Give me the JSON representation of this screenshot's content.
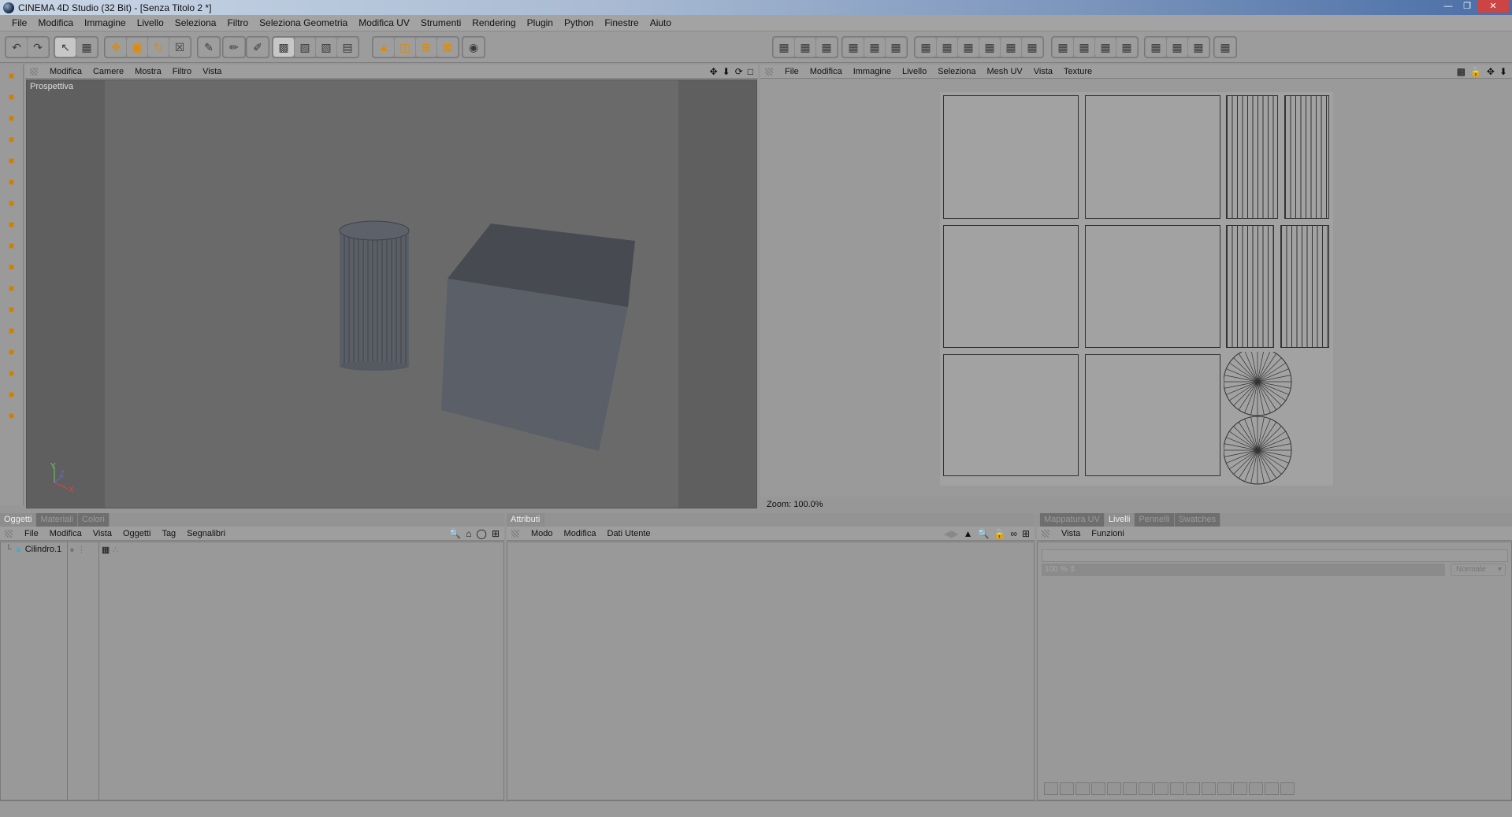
{
  "window": {
    "title": "CINEMA 4D Studio (32 Bit) - [Senza Titolo 2 *]",
    "controls": [
      "minimize",
      "restore",
      "close"
    ]
  },
  "menu": [
    "File",
    "Modifica",
    "Immagine",
    "Livello",
    "Seleziona",
    "Filtro",
    "Seleziona Geometria",
    "Modifica UV",
    "Strumenti",
    "Rendering",
    "Plugin",
    "Python",
    "Finestre",
    "Aiuto"
  ],
  "toolbar_left": [
    "undo-icon",
    "redo-icon",
    "live-selection-icon",
    "rectangle-select-icon",
    "move-icon",
    "scale-icon",
    "rotate-icon",
    "lock-texture-icon",
    "paint-icon",
    "3d-paint-icon",
    "brush-icon",
    "texture-mode-icon",
    "uv-points-icon",
    "uv-polygons-icon",
    "uv-edit-icon",
    "axis-icon",
    "layout-1-icon",
    "layout-2-icon",
    "layout-3-icon",
    "render-icon"
  ],
  "toolbar_right": [
    "uv-tool-1",
    "uv-tool-2",
    "uv-tool-3",
    "uv-tool-4",
    "uv-tool-5",
    "uv-tool-6",
    "uv-tool-7",
    "uv-tool-8",
    "uv-tool-9",
    "uv-tool-10",
    "uv-tool-11",
    "uv-tool-12",
    "uv-tool-13",
    "uv-tool-14",
    "uv-tool-15",
    "uv-tool-16",
    "uv-tool-17",
    "uv-tool-18",
    "uv-tool-19",
    "uv-tool-20"
  ],
  "left_tools": [
    "layout-icon",
    "move-icon",
    "rect-select-icon",
    "magic-wand-icon",
    "pointer-icon",
    "pencil-icon",
    "stamp-icon",
    "eraser-icon",
    "fill-icon",
    "drop-icon",
    "magnify-icon",
    "text-icon",
    "star-icon",
    "eyedropper-icon",
    "clone-icon",
    "color-swatch-icon",
    "layer-icon"
  ],
  "viewport": {
    "menu": [
      "Modifica",
      "Camere",
      "Mostra",
      "Filtro",
      "Vista"
    ],
    "label": "Prospettiva",
    "axis": {
      "y": "Y",
      "z": "Z",
      "x": "X"
    }
  },
  "uv_editor": {
    "menu": [
      "File",
      "Modifica",
      "Immagine",
      "Livello",
      "Seleziona",
      "Mesh UV",
      "Vista",
      "Texture"
    ],
    "zoom": "Zoom: 100.0%"
  },
  "objects_panel": {
    "tabs": [
      "Oggetti",
      "Materiali",
      "Colori"
    ],
    "active_tab": 0,
    "menu": [
      "File",
      "Modifica",
      "Vista",
      "Oggetti",
      "Tag",
      "Segnalibri"
    ],
    "items": [
      {
        "name": "Cilindro.1"
      }
    ]
  },
  "attributes_panel": {
    "tabs": [
      "Attributi"
    ],
    "menu": [
      "Modo",
      "Modifica",
      "Dati Utente"
    ]
  },
  "layers_panel": {
    "tabs": [
      "Mappatura UV",
      "Livelli",
      "Pennelli",
      "Swatches"
    ],
    "active_tab": 1,
    "menu": [
      "Vista",
      "Funzioni"
    ],
    "opacity": "100 %",
    "blend_mode": "Normale"
  },
  "colors": {
    "accent": "#e08a00",
    "viewport_bg": "#6a6a6a",
    "panel_bg": "#999999"
  }
}
